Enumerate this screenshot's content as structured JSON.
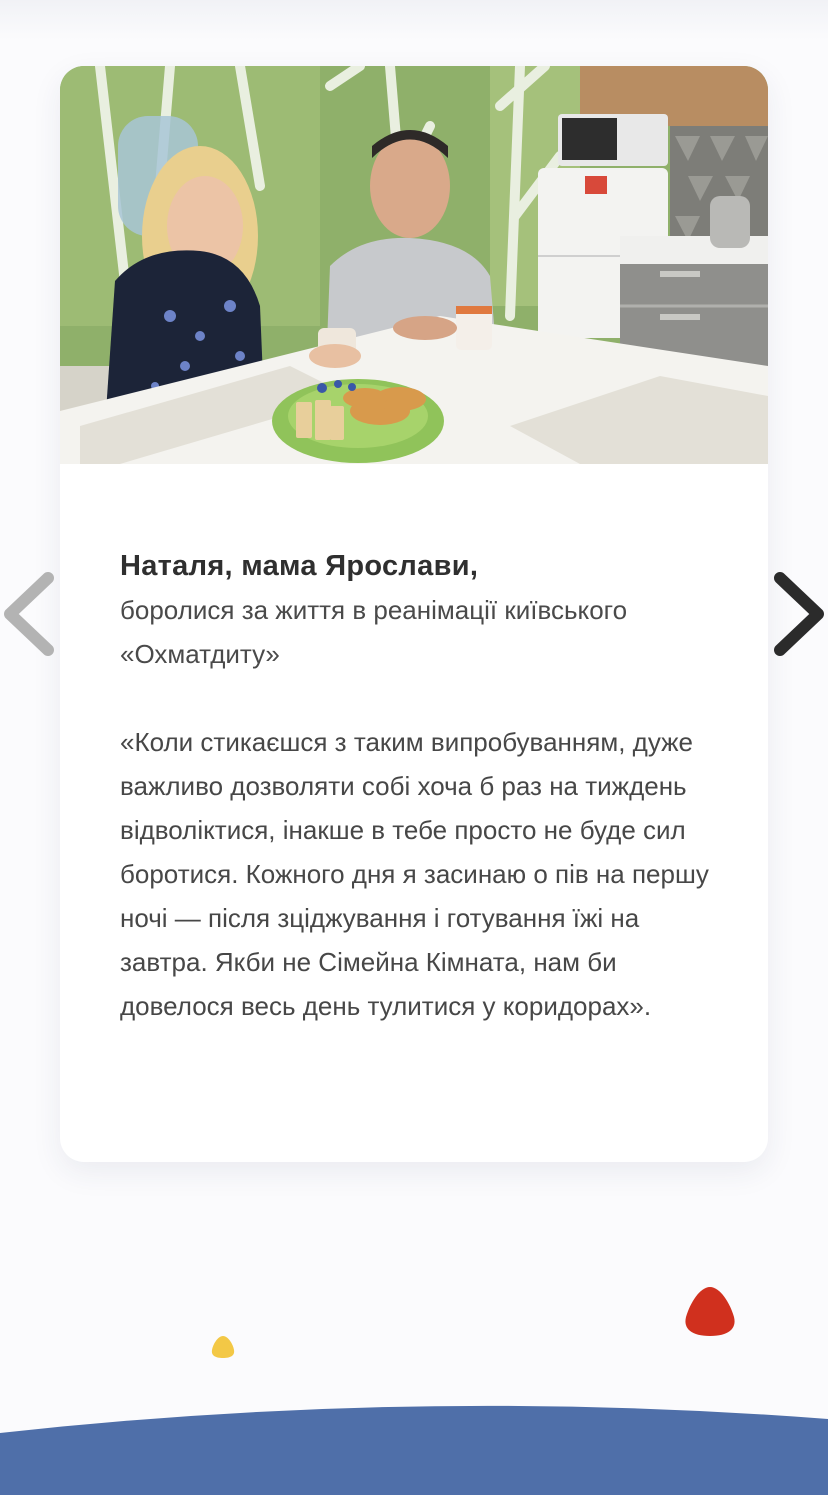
{
  "testimonial": {
    "person": "Наталя, мама Ярослави,",
    "description": "боролися за життя в реанімації київського «Охматдиту»",
    "quote": "«Коли стикаєшся з таким випробуванням, дуже важливо дозволяти собі хоча б раз на тиждень відволіктися, інакше в тебе просто не буде сил боротися. Кожного дня я засинаю о пів на першу ночі — після зціджування і готування їжі на завтра. Якби не Сімейна Кімната, нам би довелося весь день тулитися у коридорах»."
  },
  "navigation": {
    "prev_icon": "chevron-left-icon",
    "next_icon": "chevron-right-icon"
  },
  "colors": {
    "prev_arrow": "#b3b3b3",
    "next_arrow": "#2b2b2b",
    "wave": "#4f6fa9",
    "red_dot": "#d0301e",
    "yellow_dot": "#f3c846",
    "card_bg": "#ffffff",
    "page_bg": "#fbfbfd"
  }
}
